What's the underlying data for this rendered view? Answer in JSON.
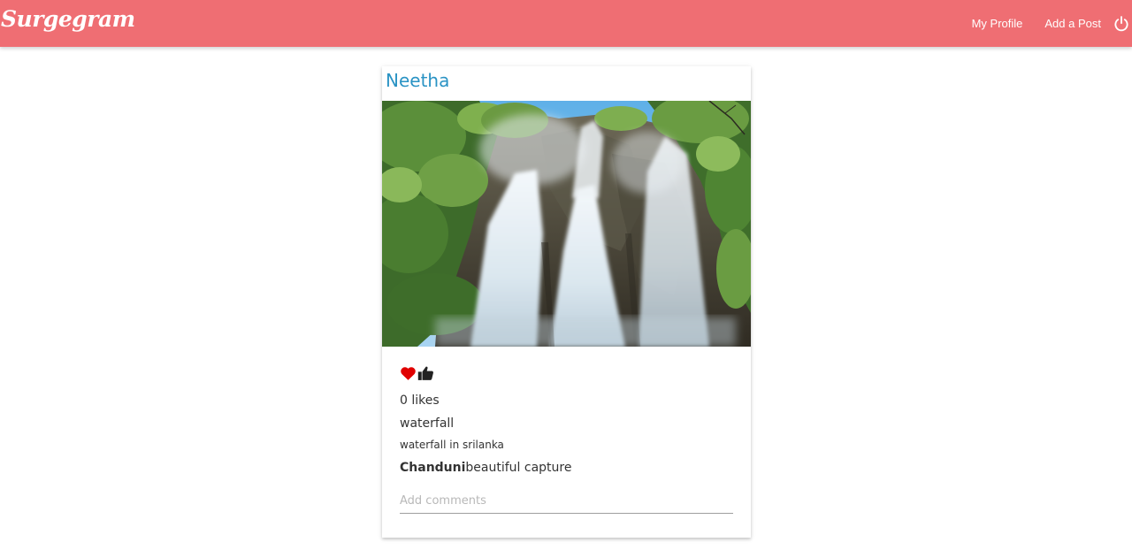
{
  "navbar": {
    "brand": "Surgegram",
    "links": {
      "my_profile": "My Profile",
      "add_post": "Add a Post"
    },
    "logout_icon": "power-icon",
    "background_color": "#ef6e73"
  },
  "post": {
    "author": "Neetha",
    "image_icon": "waterfall-photo",
    "like_count_text": "0 likes",
    "title": "waterfall",
    "body": "waterfall in srilanka",
    "comments": [
      {
        "author": "Chanduni",
        "text": "beautiful capture"
      }
    ],
    "comment_input": {
      "placeholder": "Add comments",
      "value": ""
    },
    "accent_color": "#2a93c4",
    "heart_color": "#e00000"
  }
}
